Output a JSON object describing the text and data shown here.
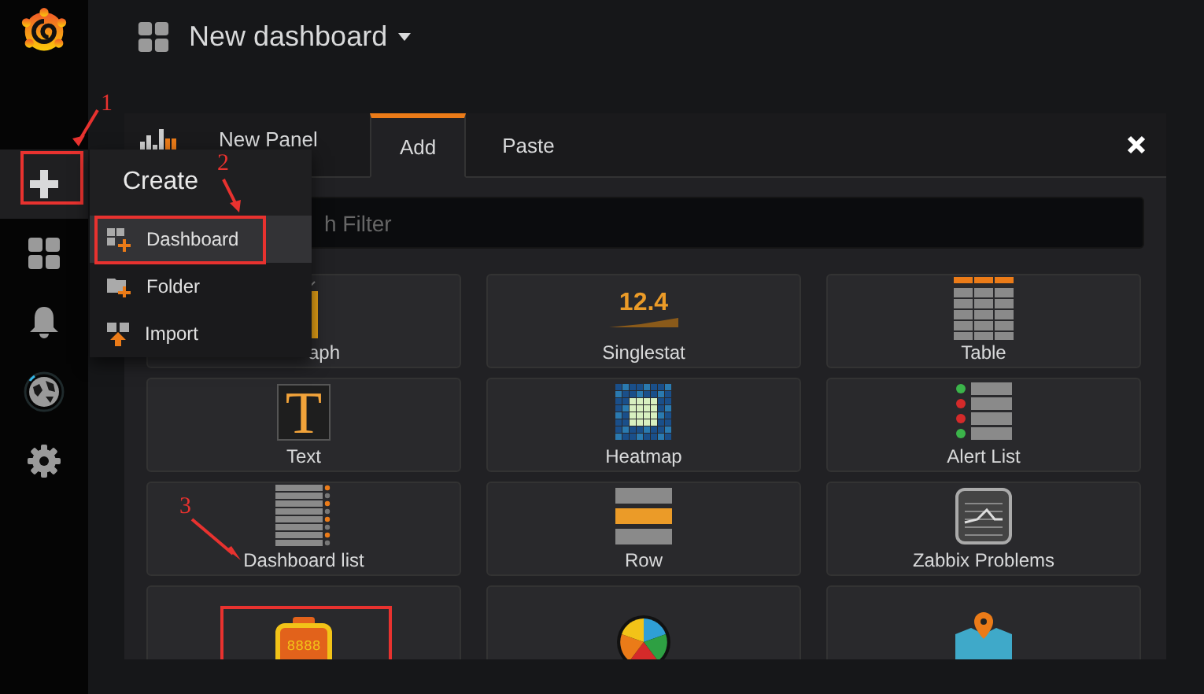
{
  "sidebar": {
    "items": [
      {
        "kind": "plus",
        "selected": true,
        "highlighted": true
      },
      {
        "kind": "dashboards",
        "selected": false,
        "highlighted": false
      },
      {
        "kind": "alerting",
        "selected": false,
        "highlighted": false
      },
      {
        "kind": "explore",
        "selected": false,
        "highlighted": false
      },
      {
        "kind": "settings",
        "selected": false,
        "highlighted": false
      }
    ]
  },
  "header": {
    "title": "New dashboard"
  },
  "panel": {
    "title": "New Panel",
    "tabs": [
      {
        "label": "Add",
        "selected": true
      },
      {
        "label": "Paste",
        "selected": false
      }
    ],
    "search": {
      "placeholder": "h Filter"
    },
    "visualizations": [
      {
        "kind": "graph",
        "label": "aph",
        "highlighted": false
      },
      {
        "kind": "singlestat",
        "label": "Singlestat",
        "sample": "12.4",
        "highlighted": false
      },
      {
        "kind": "table",
        "label": "Table",
        "highlighted": false
      },
      {
        "kind": "text",
        "label": "Text",
        "sample": "T",
        "highlighted": false
      },
      {
        "kind": "heatmap",
        "label": "Heatmap",
        "highlighted": false
      },
      {
        "kind": "alertlist",
        "label": "Alert List",
        "highlighted": false
      },
      {
        "kind": "dashlist",
        "label": "Dashboard list",
        "highlighted": false
      },
      {
        "kind": "row",
        "label": "Row",
        "highlighted": false
      },
      {
        "kind": "zabbix",
        "label": "Zabbix Problems",
        "highlighted": false
      },
      {
        "kind": "clock",
        "sample": "8888",
        "highlighted": true
      },
      {
        "kind": "piechart",
        "highlighted": false
      },
      {
        "kind": "worldmap",
        "highlighted": false
      }
    ]
  },
  "create_menu": {
    "title": "Create",
    "items": [
      {
        "kind": "dashboard",
        "label": "Dashboard",
        "selected": true,
        "highlighted": true
      },
      {
        "kind": "folder",
        "label": "Folder",
        "selected": false,
        "highlighted": false
      },
      {
        "kind": "import",
        "label": "Import",
        "selected": false,
        "highlighted": false
      }
    ]
  },
  "annotations": [
    {
      "label": "1"
    },
    {
      "label": "2"
    },
    {
      "label": "3"
    }
  ]
}
